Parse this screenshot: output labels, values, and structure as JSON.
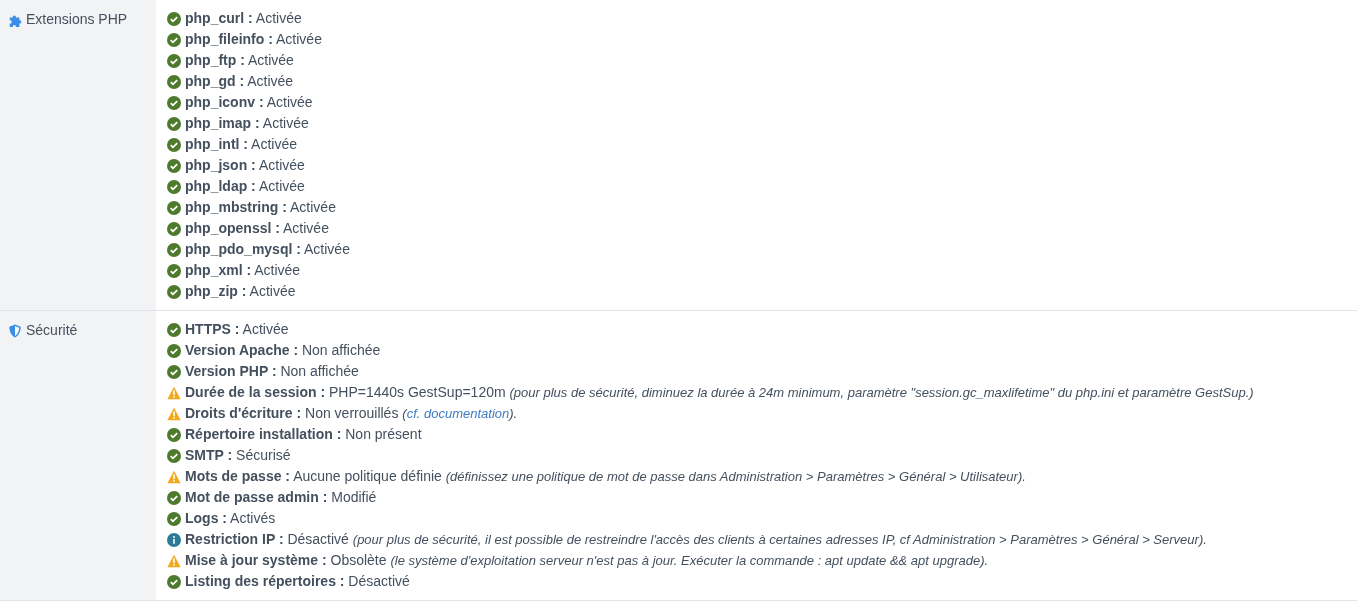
{
  "sections": [
    {
      "title": "Extensions PHP",
      "items": [
        {
          "kind": "ok",
          "label": "php_curl :",
          "value": "Activée"
        },
        {
          "kind": "ok",
          "label": "php_fileinfo :",
          "value": "Activée"
        },
        {
          "kind": "ok",
          "label": "php_ftp :",
          "value": "Activée"
        },
        {
          "kind": "ok",
          "label": "php_gd :",
          "value": "Activée"
        },
        {
          "kind": "ok",
          "label": "php_iconv :",
          "value": "Activée"
        },
        {
          "kind": "ok",
          "label": "php_imap :",
          "value": "Activée"
        },
        {
          "kind": "ok",
          "label": "php_intl :",
          "value": "Activée"
        },
        {
          "kind": "ok",
          "label": "php_json :",
          "value": "Activée"
        },
        {
          "kind": "ok",
          "label": "php_ldap :",
          "value": "Activée"
        },
        {
          "kind": "ok",
          "label": "php_mbstring :",
          "value": "Activée"
        },
        {
          "kind": "ok",
          "label": "php_openssl :",
          "value": "Activée"
        },
        {
          "kind": "ok",
          "label": "php_pdo_mysql :",
          "value": "Activée"
        },
        {
          "kind": "ok",
          "label": "php_xml :",
          "value": "Activée"
        },
        {
          "kind": "ok",
          "label": "php_zip :",
          "value": "Activée"
        }
      ]
    },
    {
      "title": "Sécurité",
      "items": [
        {
          "kind": "ok",
          "label": "HTTPS :",
          "value": "Activée"
        },
        {
          "kind": "ok",
          "label": "Version Apache :",
          "value": "Non affichée"
        },
        {
          "kind": "ok",
          "label": "Version PHP :",
          "value": "Non affichée"
        },
        {
          "kind": "warning",
          "label": "Durée de la session :",
          "value": "PHP=1440s GestSup=120m",
          "note": "(pour plus de sécurité, diminuez la durée à 24m minimum, paramètre \"session.gc_maxlifetime\" du php.ini et paramètre GestSup.)"
        },
        {
          "kind": "warning",
          "label": "Droits d'écriture :",
          "value": "Non verrouillés",
          "note": "(",
          "link": "cf. documentation",
          "note_end": ")."
        },
        {
          "kind": "ok",
          "label": "Répertoire installation :",
          "value": "Non présent"
        },
        {
          "kind": "ok",
          "label": "SMTP :",
          "value": "Sécurisé"
        },
        {
          "kind": "warning",
          "label": "Mots de passe :",
          "value": "Aucune politique définie",
          "note": "(définissez une politique de mot de passe dans Administration > Paramètres > Général > Utilisateur)."
        },
        {
          "kind": "ok",
          "label": "Mot de passe admin :",
          "value": "Modifié"
        },
        {
          "kind": "ok",
          "label": "Logs :",
          "value": "Activés"
        },
        {
          "kind": "info",
          "label": "Restriction IP :",
          "value": "Désactivé",
          "note": "(pour plus de sécurité, il est possible de restreindre l'accès des clients à certaines adresses IP, cf Administration > Paramètres > Général > Serveur)."
        },
        {
          "kind": "warning",
          "label": "Mise à jour système :",
          "value": "Obsolète",
          "note": "(le système d'exploitation serveur n'est pas à jour. Exécuter la commande : apt update && apt upgrade)."
        },
        {
          "kind": "ok",
          "label": "Listing des répertoires :",
          "value": "Désactivé"
        }
      ]
    }
  ]
}
